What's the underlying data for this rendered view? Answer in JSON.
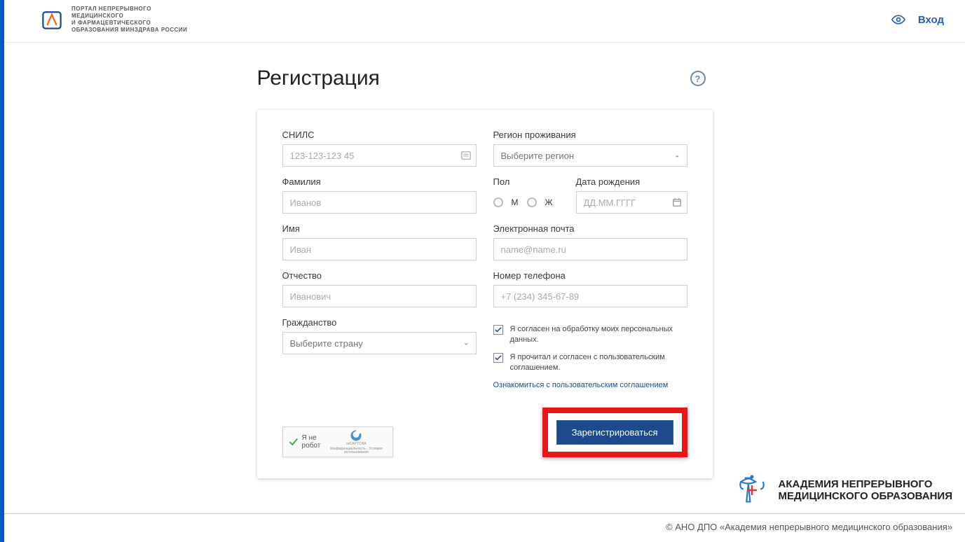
{
  "header": {
    "brand_line1": "ПОРТАЛ НЕПРЕРЫВНОГО",
    "brand_line2": "МЕДИЦИНСКОГО",
    "brand_line3": "И ФАРМАЦЕВТИЧЕСКОГО",
    "brand_line4": "ОБРАЗОВАНИЯ МИНЗДРАВА РОССИИ",
    "login_label": "Вход"
  },
  "page": {
    "title": "Регистрация",
    "help_glyph": "?"
  },
  "form": {
    "snils": {
      "label": "СНИЛС",
      "placeholder": "123-123-123 45"
    },
    "lastname": {
      "label": "Фамилия",
      "placeholder": "Иванов"
    },
    "firstname": {
      "label": "Имя",
      "placeholder": "Иван"
    },
    "patronymic": {
      "label": "Отчество",
      "placeholder": "Иванович"
    },
    "citizenship": {
      "label": "Гражданство",
      "placeholder": "Выберите страну"
    },
    "region": {
      "label": "Регион проживания",
      "placeholder": "Выберите регион"
    },
    "gender": {
      "label": "Пол",
      "male": "М",
      "female": "Ж"
    },
    "birthdate": {
      "label": "Дата рождения",
      "placeholder": "ДД.ММ.ГГГГ"
    },
    "email": {
      "label": "Электронная почта",
      "placeholder": "name@name.ru"
    },
    "phone": {
      "label": "Номер телефона",
      "placeholder": "+7 (234) 345-67-89"
    },
    "consent_personal": "Я согласен на обработку моих персональных данных.",
    "consent_agreement": "Я прочитал и согласен с пользовательским соглашением.",
    "agreement_link": "Ознакомиться с пользовательским соглашением",
    "captcha_text": "Я не робот",
    "captcha_brand": "reCAPTCHA",
    "captcha_small": "Конфиденциальность - Условия использования",
    "submit_label": "Зарегистрироваться"
  },
  "footer": {
    "logo_line1": "АКАДЕМИЯ НЕПРЕРЫВНОГО",
    "logo_line2": "МЕДИЦИНСКОГО ОБРАЗОВАНИЯ",
    "copyright": "© АНО ДПО «Академия непрерывного медицинского образования»"
  }
}
